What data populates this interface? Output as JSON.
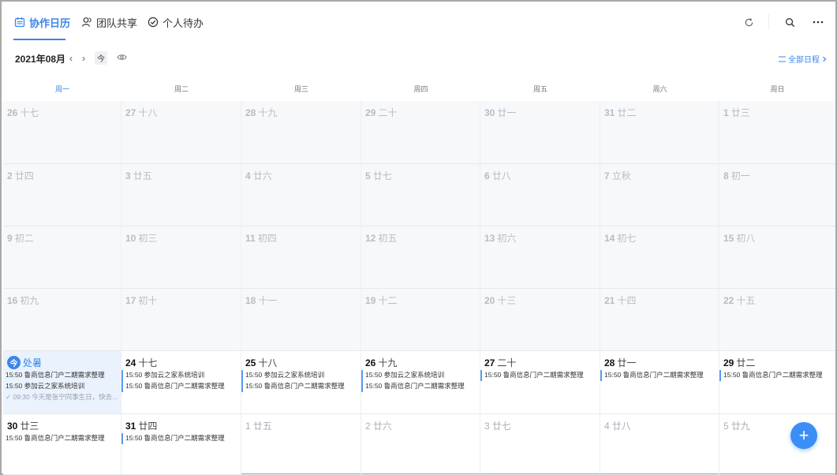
{
  "tabs": [
    {
      "label": "协作日历",
      "icon": "calendar-icon",
      "active": true
    },
    {
      "label": "团队共享",
      "icon": "team-icon",
      "active": false
    },
    {
      "label": "个人待办",
      "icon": "check-circle-icon",
      "active": false
    }
  ],
  "topbar_icons": [
    "refresh-icon",
    "search-icon",
    "more-icon"
  ],
  "toolbar": {
    "month_label": "2021年08月",
    "prev": "‹",
    "next": "›",
    "today_label": "今",
    "all_schedule": "全部日程"
  },
  "weekdays": [
    "周一",
    "周二",
    "周三",
    "周四",
    "周五",
    "周六",
    "周日"
  ],
  "weeks": [
    [
      {
        "n": "26",
        "l": "十七",
        "kind": "past"
      },
      {
        "n": "27",
        "l": "十八",
        "kind": "past"
      },
      {
        "n": "28",
        "l": "十九",
        "kind": "past"
      },
      {
        "n": "29",
        "l": "二十",
        "kind": "past"
      },
      {
        "n": "30",
        "l": "廿一",
        "kind": "past"
      },
      {
        "n": "31",
        "l": "廿二",
        "kind": "past"
      },
      {
        "n": "1",
        "l": "廿三",
        "kind": "past"
      }
    ],
    [
      {
        "n": "2",
        "l": "廿四",
        "kind": "past"
      },
      {
        "n": "3",
        "l": "廿五",
        "kind": "past"
      },
      {
        "n": "4",
        "l": "廿六",
        "kind": "past"
      },
      {
        "n": "5",
        "l": "廿七",
        "kind": "past"
      },
      {
        "n": "6",
        "l": "廿八",
        "kind": "past"
      },
      {
        "n": "7",
        "l": "立秋",
        "kind": "past"
      },
      {
        "n": "8",
        "l": "初一",
        "kind": "past"
      }
    ],
    [
      {
        "n": "9",
        "l": "初二",
        "kind": "past"
      },
      {
        "n": "10",
        "l": "初三",
        "kind": "past"
      },
      {
        "n": "11",
        "l": "初四",
        "kind": "past"
      },
      {
        "n": "12",
        "l": "初五",
        "kind": "past"
      },
      {
        "n": "13",
        "l": "初六",
        "kind": "past"
      },
      {
        "n": "14",
        "l": "初七",
        "kind": "past"
      },
      {
        "n": "15",
        "l": "初八",
        "kind": "past"
      }
    ],
    [
      {
        "n": "16",
        "l": "初九",
        "kind": "past"
      },
      {
        "n": "17",
        "l": "初十",
        "kind": "past"
      },
      {
        "n": "18",
        "l": "十一",
        "kind": "past"
      },
      {
        "n": "19",
        "l": "十二",
        "kind": "past"
      },
      {
        "n": "20",
        "l": "十三",
        "kind": "past"
      },
      {
        "n": "21",
        "l": "十四",
        "kind": "past"
      },
      {
        "n": "22",
        "l": "十五",
        "kind": "past"
      }
    ],
    [
      {
        "n": "今",
        "l": "处暑",
        "kind": "today",
        "events": [
          {
            "text": "15:50 鲁商信息门户二期需求整理",
            "style": "plain"
          },
          {
            "text": "15:50 参加云之家系统培训",
            "style": "plain"
          },
          {
            "text": "✓ 09:30 今天是张宁同事生日，快去...",
            "style": "done"
          }
        ]
      },
      {
        "n": "24",
        "l": "十七",
        "kind": "cur",
        "events": [
          {
            "text": "15:50 参加云之家系统培训",
            "style": "bar"
          },
          {
            "text": "15:50 鲁商信息门户二期需求整理",
            "style": "bar"
          }
        ]
      },
      {
        "n": "25",
        "l": "十八",
        "kind": "cur",
        "events": [
          {
            "text": "15:50 参加云之家系统培训",
            "style": "bar"
          },
          {
            "text": "15:50 鲁商信息门户二期需求整理",
            "style": "bar"
          }
        ]
      },
      {
        "n": "26",
        "l": "十九",
        "kind": "cur",
        "events": [
          {
            "text": "15:50 参加云之家系统培训",
            "style": "bar"
          },
          {
            "text": "15:50 鲁商信息门户二期需求整理",
            "style": "bar"
          }
        ]
      },
      {
        "n": "27",
        "l": "二十",
        "kind": "cur",
        "events": [
          {
            "text": "15:50 鲁商信息门户二期需求整理",
            "style": "bar"
          }
        ]
      },
      {
        "n": "28",
        "l": "廿一",
        "kind": "cur",
        "events": [
          {
            "text": "15:50 鲁商信息门户二期需求整理",
            "style": "bar"
          }
        ]
      },
      {
        "n": "29",
        "l": "廿二",
        "kind": "cur",
        "events": [
          {
            "text": "15:50 鲁商信息门户二期需求整理",
            "style": "bar"
          }
        ]
      }
    ],
    [
      {
        "n": "30",
        "l": "廿三",
        "kind": "cur",
        "events": [
          {
            "text": "15:50 鲁商信息门户二期需求整理",
            "style": "plain"
          }
        ]
      },
      {
        "n": "31",
        "l": "廿四",
        "kind": "cur",
        "events": [
          {
            "text": "15:50 鲁商信息门户二期需求整理",
            "style": "bar"
          }
        ]
      },
      {
        "n": "1",
        "l": "廿五",
        "kind": "next"
      },
      {
        "n": "2",
        "l": "廿六",
        "kind": "next"
      },
      {
        "n": "3",
        "l": "廿七",
        "kind": "next"
      },
      {
        "n": "4",
        "l": "廿八",
        "kind": "next"
      },
      {
        "n": "5",
        "l": "廿九",
        "kind": "next"
      }
    ]
  ],
  "fab_label": "+",
  "colors": {
    "accent": "#3b86e8",
    "fab": "#3b8ef5",
    "today_bg": "#eaf2fd",
    "past_bg": "#f7f8fa"
  }
}
